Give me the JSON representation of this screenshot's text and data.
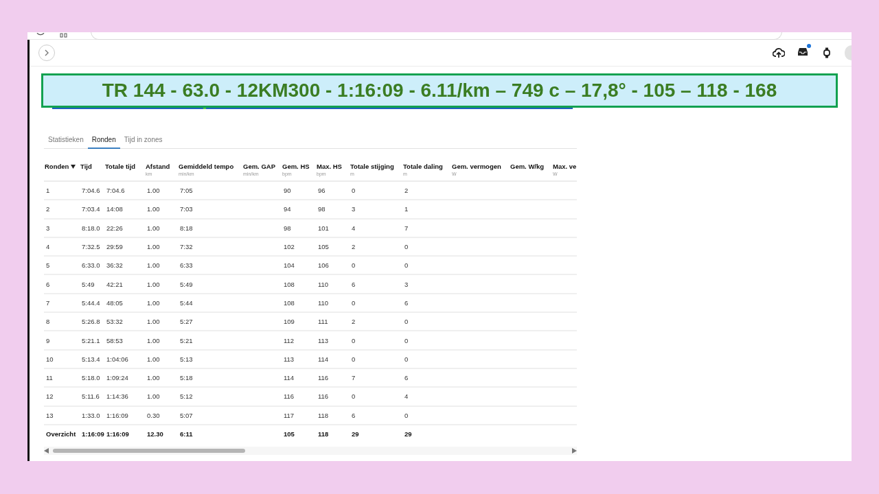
{
  "banner": {
    "text": "TR 144 - 63.0 - 12KM300 - 1:16:09 - 6.11/km – 749 c – 17,8° - 105 – 118 - 168"
  },
  "header": {
    "notification_dot": true
  },
  "tabs": [
    {
      "label": "Statistieken",
      "selected": false
    },
    {
      "label": "Ronden",
      "selected": true
    },
    {
      "label": "Tijd in zones",
      "selected": false
    }
  ],
  "table": {
    "columns": [
      {
        "label": "Ronden",
        "sorted": true
      },
      {
        "label": "Tijd",
        "sorted": false
      },
      {
        "label": "Totale tijd",
        "sorted": false
      },
      {
        "label": "Afstand",
        "unit": "km",
        "sorted": false
      },
      {
        "label": "Gemiddeld tempo",
        "unit": "min/km",
        "sorted": false
      },
      {
        "label": "Gem. GAP",
        "unit": "min/km",
        "sorted": false
      },
      {
        "label": "Gem. HS",
        "unit": "bpm",
        "sorted": false
      },
      {
        "label": "Max. HS",
        "unit": "bpm",
        "sorted": false
      },
      {
        "label": "Totale stijging",
        "unit": "m",
        "sorted": false
      },
      {
        "label": "Totale daling",
        "unit": "m",
        "sorted": false
      },
      {
        "label": "Gem. vermogen",
        "unit": "W",
        "sorted": false
      },
      {
        "label": "Gem. W/kg",
        "sorted": false
      },
      {
        "label": "Max. ve",
        "unit": "W",
        "sorted": false
      }
    ],
    "rows": [
      {
        "cells": [
          "1",
          "7:04.6",
          "7:04.6",
          "1.00",
          "7:05",
          "",
          "90",
          "96",
          "0",
          "2"
        ]
      },
      {
        "cells": [
          "2",
          "7:03.4",
          "14:08",
          "1.00",
          "7:03",
          "",
          "94",
          "98",
          "3",
          "1"
        ]
      },
      {
        "cells": [
          "3",
          "8:18.0",
          "22:26",
          "1.00",
          "8:18",
          "",
          "98",
          "101",
          "4",
          "7"
        ]
      },
      {
        "cells": [
          "4",
          "7:32.5",
          "29:59",
          "1.00",
          "7:32",
          "",
          "102",
          "105",
          "2",
          "0"
        ]
      },
      {
        "cells": [
          "5",
          "6:33.0",
          "36:32",
          "1.00",
          "6:33",
          "",
          "104",
          "106",
          "0",
          "0"
        ]
      },
      {
        "cells": [
          "6",
          "5:49",
          "42:21",
          "1.00",
          "5:49",
          "",
          "108",
          "110",
          "6",
          "3"
        ]
      },
      {
        "cells": [
          "7",
          "5:44.4",
          "48:05",
          "1.00",
          "5:44",
          "",
          "108",
          "110",
          "0",
          "6"
        ]
      },
      {
        "cells": [
          "8",
          "5:26.8",
          "53:32",
          "1.00",
          "5:27",
          "",
          "109",
          "111",
          "2",
          "0"
        ]
      },
      {
        "cells": [
          "9",
          "5:21.1",
          "58:53",
          "1.00",
          "5:21",
          "",
          "112",
          "113",
          "0",
          "0"
        ]
      },
      {
        "cells": [
          "10",
          "5:13.4",
          "1:04:06",
          "1.00",
          "5:13",
          "",
          "113",
          "114",
          "0",
          "0"
        ]
      },
      {
        "cells": [
          "11",
          "5:18.0",
          "1:09:24",
          "1.00",
          "5:18",
          "",
          "114",
          "116",
          "7",
          "6"
        ]
      },
      {
        "cells": [
          "12",
          "5:11.6",
          "1:14:36",
          "1.00",
          "5:12",
          "",
          "116",
          "116",
          "0",
          "4"
        ]
      },
      {
        "cells": [
          "13",
          "1:33.0",
          "1:16:09",
          "0.30",
          "5:07",
          "",
          "117",
          "118",
          "6",
          "0"
        ]
      }
    ],
    "summary": {
      "cells": [
        "Overzicht",
        "1:16:09",
        "1:16:09",
        "12.30",
        "6:11",
        "",
        "105",
        "118",
        "29",
        "29"
      ]
    }
  }
}
